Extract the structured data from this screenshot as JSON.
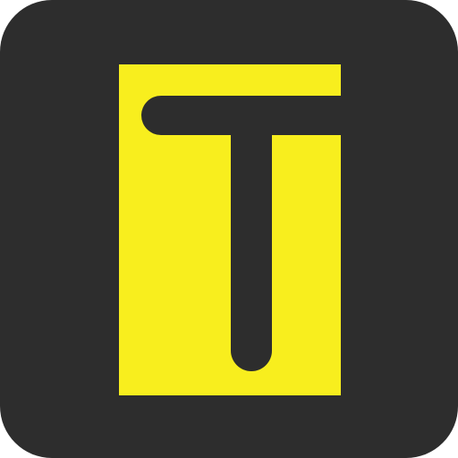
{
  "app_icon": {
    "name": "T app icon",
    "background_color": "#2d2d2d",
    "accent_color": "#f8ee1e",
    "letter_color": "#2d2d2d",
    "logo_letter": "T"
  }
}
